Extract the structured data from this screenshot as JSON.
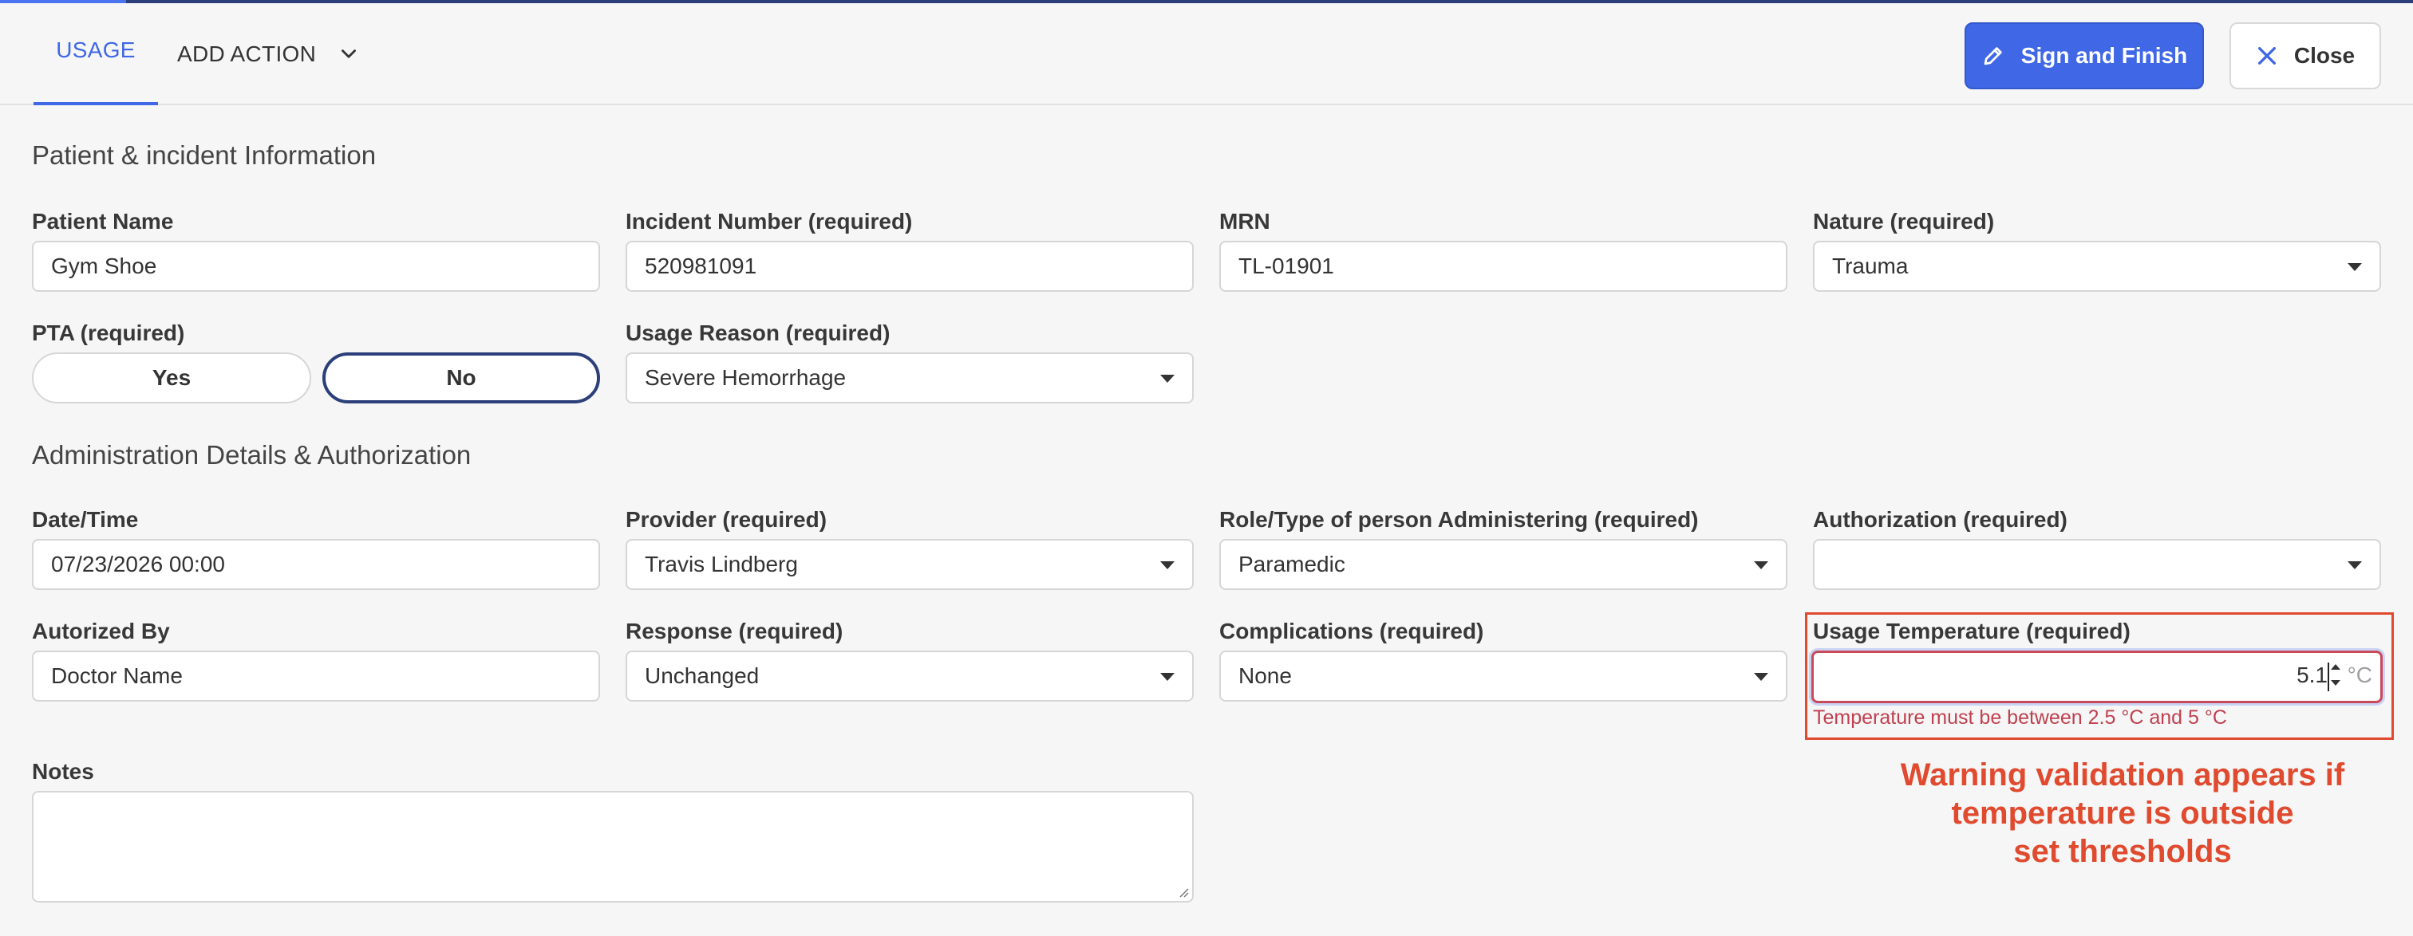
{
  "header": {
    "tabs": [
      {
        "label": "USAGE"
      },
      {
        "label": "ADD ACTION"
      }
    ],
    "sign_label": "Sign and Finish",
    "close_label": "Close"
  },
  "patient_section": {
    "title": "Patient & incident Information",
    "patient_name": {
      "label": "Patient Name",
      "value": "Gym Shoe"
    },
    "incident_number": {
      "label": "Incident Number (required)",
      "value": "520981091"
    },
    "mrn": {
      "label": "MRN",
      "value": "TL-01901"
    },
    "nature": {
      "label": "Nature (required)",
      "value": "Trauma"
    },
    "pta": {
      "label": "PTA (required)",
      "yes": "Yes",
      "no": "No",
      "selected": "No"
    },
    "usage_reason": {
      "label": "Usage Reason (required)",
      "value": "Severe Hemorrhage"
    }
  },
  "admin_section": {
    "title": "Administration Details & Authorization",
    "datetime": {
      "label": "Date/Time",
      "value": "07/23/2026 00:00"
    },
    "provider": {
      "label": "Provider (required)",
      "value": "Travis Lindberg"
    },
    "role": {
      "label": "Role/Type of person Administering (required)",
      "value": "Paramedic"
    },
    "authorization": {
      "label": "Authorization (required)",
      "value": ""
    },
    "authorized_by": {
      "label": "Autorized By",
      "value": "Doctor Name"
    },
    "response": {
      "label": "Response (required)",
      "value": "Unchanged"
    },
    "complications": {
      "label": "Complications (required)",
      "value": "None"
    },
    "temperature": {
      "label": "Usage Temperature (required)",
      "value": "5.1",
      "unit": "°C",
      "error": "Temperature must be between 2.5 °C and 5 °C"
    },
    "notes": {
      "label": "Notes",
      "value": ""
    }
  },
  "annotation": "Warning validation appears if\ntemperature is outside\nset thresholds",
  "colors": {
    "accent": "#3f67e6",
    "error": "#c0404f",
    "annotation": "#e04a2e",
    "selected_toggle": "#2b3f7a"
  }
}
